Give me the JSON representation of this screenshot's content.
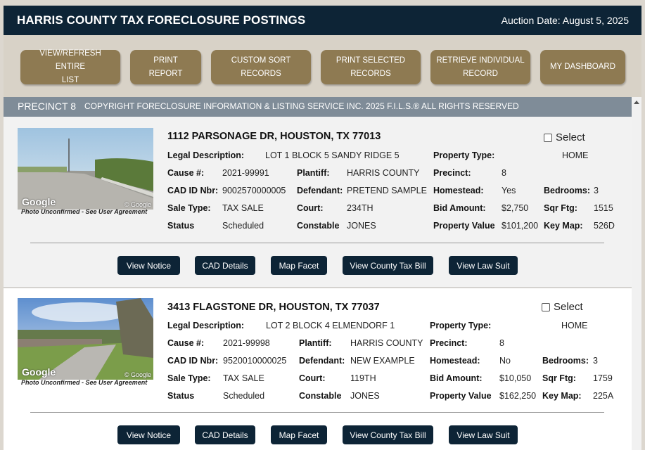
{
  "header": {
    "title": "HARRIS COUNTY TAX FORECLOSURE POSTINGS",
    "auction_date": "Auction Date: August 5, 2025"
  },
  "toolbar": {
    "buttons": [
      {
        "line1": "VIEW/REFRESH ENTIRE",
        "line2": "LIST"
      },
      {
        "line1": "PRINT REPORT",
        "line2": ""
      },
      {
        "line1": "CUSTOM SORT",
        "line2": "RECORDS"
      },
      {
        "line1": "PRINT SELECTED",
        "line2": "RECORDS"
      },
      {
        "line1": "RETRIEVE INDIVIDUAL",
        "line2": "RECORD"
      },
      {
        "line1": "MY DASHBOARD",
        "line2": ""
      }
    ]
  },
  "precinct": {
    "name": "PRECINCT 8",
    "copyright": "COPYRIGHT FORECLOSURE INFORMATION & LISTING SERVICE INC. 2025 F.I.L.S.® ALL RIGHTS RESERVED"
  },
  "labels": {
    "legal": "Legal Description:",
    "cause": "Cause #:",
    "cad": "CAD ID Nbr:",
    "sale_type": "Sale Type:",
    "status": "Status",
    "plaintiff": "Plantiff:",
    "defendant": "Defendant:",
    "court": "Court:",
    "constable": "Constable",
    "property_type": "Property Type:",
    "precinct": "Precinct:",
    "homestead": "Homestead:",
    "bid": "Bid Amount:",
    "value": "Property Value",
    "bedrooms": "Bedrooms:",
    "sqft": "Sqr Ftg:",
    "keymap": "Key Map:",
    "select": "Select",
    "photo_note": "Photo Unconfirmed - See User Agreement",
    "google": "Google",
    "google_copy": "© Google"
  },
  "actions": [
    "View Notice",
    "CAD Details",
    "Map Facet",
    "View County Tax Bill",
    "View Law Suit"
  ],
  "listings": [
    {
      "address": "1112 PARSONAGE DR, HOUSTON, TX 77013",
      "legal": "LOT 1 BLOCK 5 SANDY RIDGE 5",
      "cause": "2021-99991",
      "cad": "9002570000005",
      "sale_type": "TAX SALE",
      "status": "Scheduled",
      "plaintiff": "HARRIS COUNTY",
      "defendant": "PRETEND SAMPLE",
      "court": "234TH",
      "constable": "JONES",
      "property_type": "HOME",
      "precinct": "8",
      "homestead": "Yes",
      "bid": "$2,750",
      "value": "$101,200",
      "bedrooms": "3",
      "sqft": "1515",
      "keymap": "526D"
    },
    {
      "address": "3413 FLAGSTONE DR, HOUSTON, TX 77037",
      "legal": "LOT 2 BLOCK 4 ELMENDORF 1",
      "cause": "2021-99998",
      "cad": "9520010000025",
      "sale_type": "TAX SALE",
      "status": "Scheduled",
      "plaintiff": "HARRIS COUNTY",
      "defendant": "NEW EXAMPLE",
      "court": "119TH",
      "constable": "JONES",
      "property_type": "HOME",
      "precinct": "8",
      "homestead": "No",
      "bid": "$10,050",
      "value": "$162,250",
      "bedrooms": "3",
      "sqft": "1759",
      "keymap": "225A"
    }
  ]
}
